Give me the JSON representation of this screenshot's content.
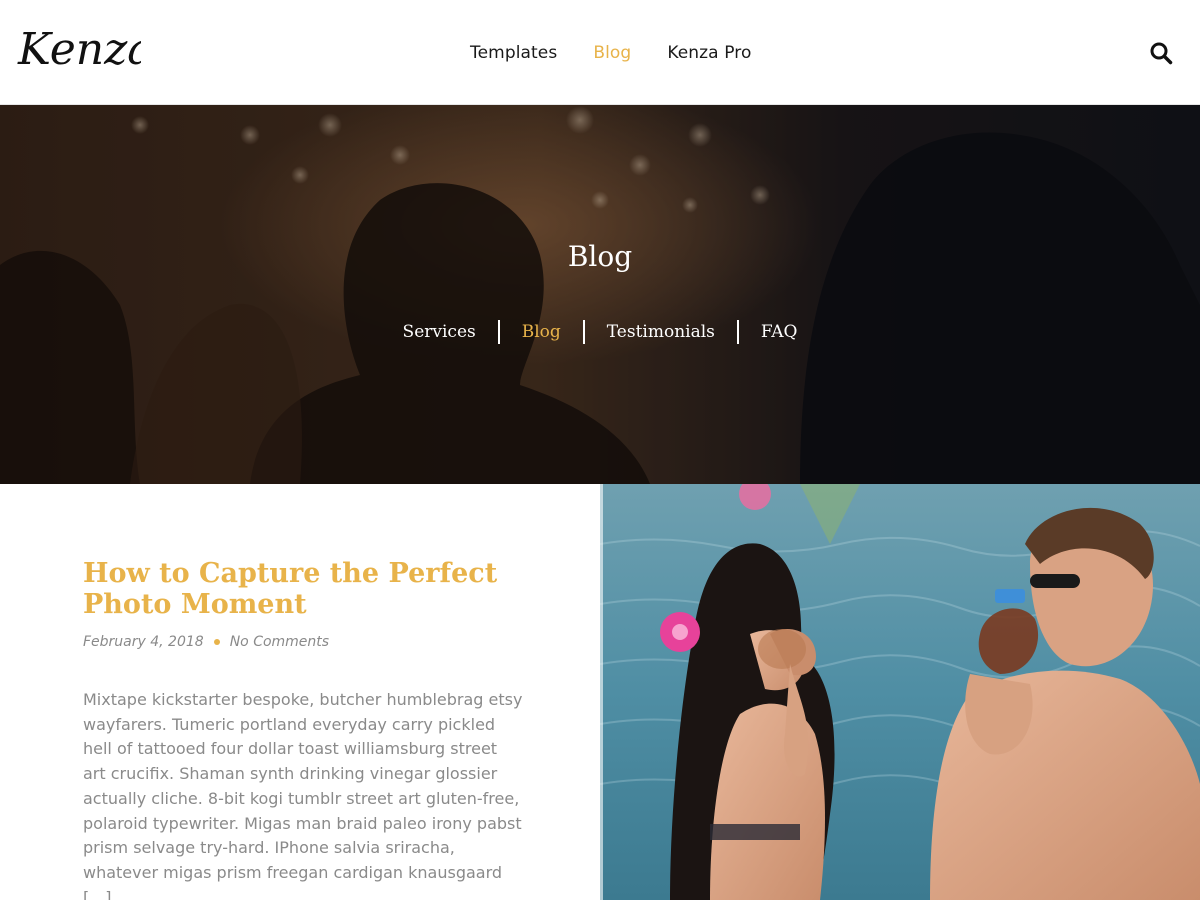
{
  "header": {
    "logo_text": "Kenza",
    "nav": [
      {
        "label": "Templates",
        "active": false
      },
      {
        "label": "Blog",
        "active": true
      },
      {
        "label": "Kenza Pro",
        "active": false
      }
    ],
    "search_icon": "search-icon"
  },
  "hero": {
    "title": "Blog",
    "subnav": [
      {
        "label": "Services",
        "active": false
      },
      {
        "label": "Blog",
        "active": true
      },
      {
        "label": "Testimonials",
        "active": false
      },
      {
        "label": "FAQ",
        "active": false
      }
    ]
  },
  "post": {
    "title": "How to Capture the Perfect Photo Moment",
    "date": "February 4, 2018",
    "comments": "No Comments",
    "excerpt": "Mixtape kickstarter bespoke, butcher humblebrag etsy wayfarers. Tumeric portland everyday carry pickled hell of tattooed four dollar toast williamsburg street art crucifix. Shaman synth drinking vinegar glossier actually cliche. 8-bit kogi tumblr street art gluten-free, polaroid typewriter. Migas man braid paleo irony pabst prism selvage try-hard. IPhone salvia sriracha, whatever migas prism freegan cardigan knausgaard […]"
  },
  "colors": {
    "accent": "#e8b34a",
    "text_muted": "#8a8a8a",
    "text_dark": "#1a1a1a"
  }
}
